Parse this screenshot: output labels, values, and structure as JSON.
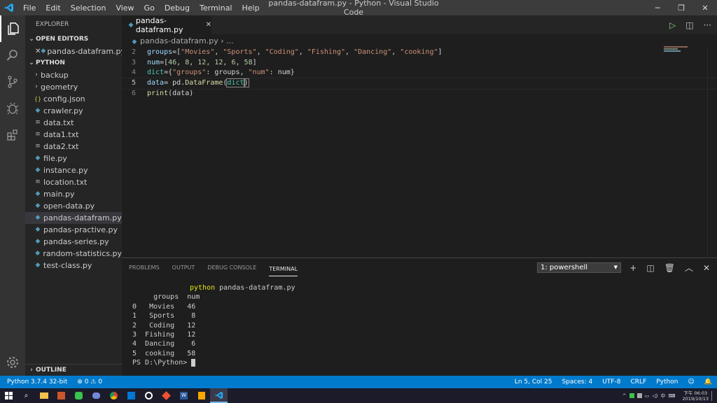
{
  "titlebar": {
    "title": "pandas-datafram.py - Python - Visual Studio Code",
    "menu": [
      "File",
      "Edit",
      "Selection",
      "View",
      "Go",
      "Debug",
      "Terminal",
      "Help"
    ]
  },
  "sidebar": {
    "title": "EXPLORER",
    "open_editors_label": "OPEN EDITORS",
    "open_editor_file": "pandas-datafram.py",
    "folder_label": "PYTHON",
    "folders": [
      "backup",
      "geometry"
    ],
    "files": [
      {
        "name": "config.json",
        "icon": "{}"
      },
      {
        "name": "crawler.py",
        "icon": "py"
      },
      {
        "name": "data.txt",
        "icon": "txt"
      },
      {
        "name": "data1.txt",
        "icon": "txt"
      },
      {
        "name": "data2.txt",
        "icon": "txt"
      },
      {
        "name": "file.py",
        "icon": "py"
      },
      {
        "name": "instance.py",
        "icon": "py"
      },
      {
        "name": "location.txt",
        "icon": "txt"
      },
      {
        "name": "main.py",
        "icon": "py"
      },
      {
        "name": "open-data.py",
        "icon": "py"
      },
      {
        "name": "pandas-datafram.py",
        "icon": "py"
      },
      {
        "name": "pandas-practive.py",
        "icon": "py"
      },
      {
        "name": "pandas-series.py",
        "icon": "py"
      },
      {
        "name": "random-statistics.py",
        "icon": "py"
      },
      {
        "name": "test-class.py",
        "icon": "py"
      }
    ],
    "outline_label": "OUTLINE"
  },
  "editor": {
    "tab": "pandas-datafram.py",
    "breadcrumb": "pandas-datafram.py › ...",
    "line_numbers": [
      "2",
      "3",
      "4",
      "5",
      "6"
    ],
    "current_line": "5"
  },
  "panel": {
    "tabs": [
      "PROBLEMS",
      "OUTPUT",
      "DEBUG CONSOLE",
      "TERMINAL"
    ],
    "active_tab": "TERMINAL",
    "terminal_select": "1: powershell",
    "command": "python pandas-datafram.py",
    "output": [
      "     groups  num",
      "0   Movies   46",
      "1   Sports    8",
      "2   Coding   12",
      "3  Fishing   12",
      "4  Dancing    6",
      "5  cooking   58"
    ],
    "prompt": "PS D:\\Python> "
  },
  "statusbar": {
    "python": "Python 3.7.4 32-bit",
    "errors": "0",
    "warnings": "0",
    "position": "Ln 5, Col 25",
    "spaces": "Spaces: 4",
    "encoding": "UTF-8",
    "eol": "CRLF",
    "language": "Python"
  },
  "taskbar": {
    "time": "下午 06:03",
    "date": "2019/10/13"
  },
  "colors": {
    "statusbar": "#007acc",
    "accent": "#0078d4",
    "string": "#ce9178",
    "number": "#b5cea8"
  }
}
